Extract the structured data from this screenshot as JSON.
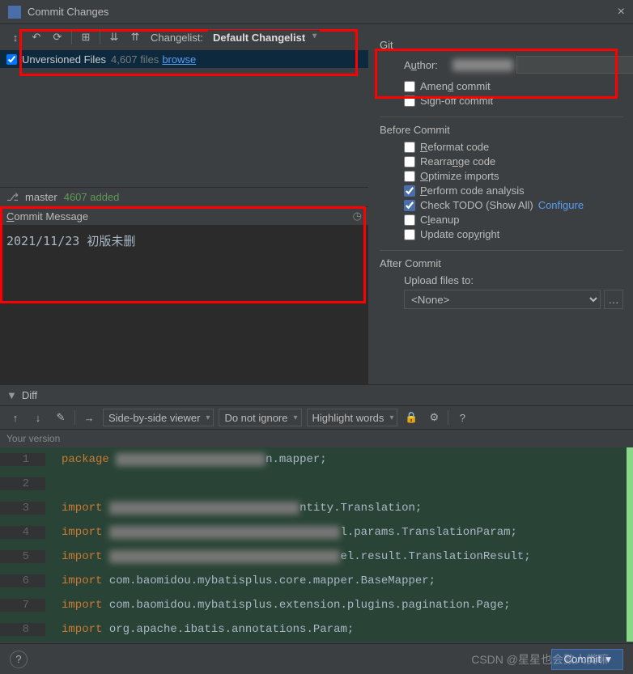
{
  "title": "Commit Changes",
  "toolbar": {
    "changelist_label": "Changelist:",
    "changelist_value": "Default Changelist"
  },
  "files": {
    "name": "Unversioned Files",
    "count": "4,607 files",
    "browse": "browse"
  },
  "branch": {
    "name": "master",
    "added": "4607 added"
  },
  "commit_message": {
    "label_html": "Commit Message",
    "value": "2021/11/23 初版未删"
  },
  "right": {
    "git_title": "Git",
    "author_label": "Author:",
    "author_value": "",
    "amend": "Amend commit",
    "signoff": "Sign-off commit",
    "before_title": "Before Commit",
    "reformat": "Reformat code",
    "rearrange": "Rearrange code",
    "optimize": "Optimize imports",
    "analysis": "Perform code analysis",
    "todo": "Check TODO (Show All)",
    "configure": "Configure",
    "cleanup": "Cleanup",
    "copyright": "Update copyright",
    "after_title": "After Commit",
    "upload_label": "Upload files to:",
    "upload_value": "<None>"
  },
  "diff": {
    "label": "Diff",
    "viewer": "Side-by-side viewer",
    "ignore": "Do not ignore",
    "highlight": "Highlight words",
    "version_label": "Your version"
  },
  "code": {
    "lines": [
      {
        "n": "1",
        "pre": "package ",
        "blur": "cn.xxx.xxxx.xxxx.xxxxx",
        "post": "n.mapper;"
      },
      {
        "n": "2",
        "pre": "",
        "blur": "",
        "post": ""
      },
      {
        "n": "3",
        "pre": "import ",
        "blur": "cn.xxxxxxxxxxx.xxxxx.xxxx.xx",
        "post": "ntity.Translation;"
      },
      {
        "n": "4",
        "pre": "import ",
        "blur": "cn.xxxxxxxxxxx.xxxxx.xxxx.xxxxx.xx",
        "post": "l.params.TranslationParam;"
      },
      {
        "n": "5",
        "pre": "import ",
        "blur": "cn.xxxxxxxxxxx.xxxxx.xxxx.xxxxx.xx",
        "post": "el.result.TranslationResult;"
      },
      {
        "n": "6",
        "pre": "import ",
        "blur": "",
        "post": "com.baomidou.mybatisplus.core.mapper.BaseMapper;"
      },
      {
        "n": "7",
        "pre": "import ",
        "blur": "",
        "post": "com.baomidou.mybatisplus.extension.plugins.pagination.Page;"
      },
      {
        "n": "8",
        "pre": "import ",
        "blur": "",
        "post": "org.apache.ibatis.annotations.",
        "cls": "Param",
        "post2": ";"
      }
    ]
  },
  "bottom": {
    "commit": "Commit"
  },
  "watermark": "CSDN @星星也会数人类嘛"
}
